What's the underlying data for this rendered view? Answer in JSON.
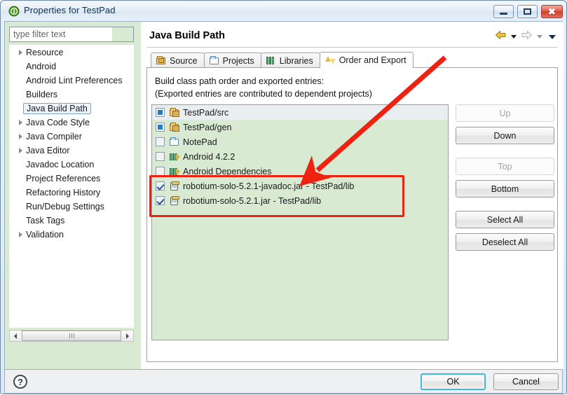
{
  "window": {
    "title": "Properties for TestPad",
    "icon": "info-circle-icon",
    "minimize_label": "Minimize",
    "maximize_label": "Maximize",
    "close_label": "Close"
  },
  "filter": {
    "placeholder": "type filter text",
    "value": ""
  },
  "sidebar": {
    "items": [
      {
        "label": "Resource",
        "expandable": true,
        "selected": false
      },
      {
        "label": "Android",
        "expandable": false,
        "selected": false
      },
      {
        "label": "Android Lint Preferences",
        "expandable": false,
        "selected": false
      },
      {
        "label": "Builders",
        "expandable": false,
        "selected": false
      },
      {
        "label": "Java Build Path",
        "expandable": false,
        "selected": true
      },
      {
        "label": "Java Code Style",
        "expandable": true,
        "selected": false
      },
      {
        "label": "Java Compiler",
        "expandable": true,
        "selected": false
      },
      {
        "label": "Java Editor",
        "expandable": true,
        "selected": false
      },
      {
        "label": "Javadoc Location",
        "expandable": false,
        "selected": false
      },
      {
        "label": "Project References",
        "expandable": false,
        "selected": false
      },
      {
        "label": "Refactoring History",
        "expandable": false,
        "selected": false
      },
      {
        "label": "Run/Debug Settings",
        "expandable": false,
        "selected": false
      },
      {
        "label": "Task Tags",
        "expandable": false,
        "selected": false
      },
      {
        "label": "Validation",
        "expandable": true,
        "selected": false
      }
    ],
    "scrollbar": {
      "left_arrow": "scroll-left-icon",
      "right_arrow": "scroll-right-icon"
    }
  },
  "main": {
    "title": "Java Build Path",
    "nav": {
      "back": "back-arrow-icon",
      "back_menu": "chevron-down-icon",
      "forward": "forward-arrow-icon",
      "forward_menu": "chevron-down-icon",
      "view_menu": "chevron-down-icon"
    },
    "tabs": [
      {
        "label": "Source",
        "icon": "source-folder-icon",
        "active": false
      },
      {
        "label": "Projects",
        "icon": "project-folder-icon",
        "active": false
      },
      {
        "label": "Libraries",
        "icon": "libraries-icon",
        "active": false
      },
      {
        "label": "Order and Export",
        "icon": "order-export-icon",
        "active": true
      }
    ],
    "description_line1": "Build class path order and exported entries:",
    "description_line2": "(Exported entries are contributed to dependent projects)",
    "entries": [
      {
        "label": "TestPad/src",
        "checkbox": "filled",
        "icon": "source-folder-icon",
        "selected": true
      },
      {
        "label": "TestPad/gen",
        "checkbox": "filled",
        "icon": "source-folder-icon",
        "selected": false
      },
      {
        "label": "NotePad",
        "checkbox": "unchecked",
        "icon": "project-folder-icon",
        "selected": false
      },
      {
        "label": "Android 4.2.2",
        "checkbox": "unchecked",
        "icon": "libraries-icon",
        "selected": false
      },
      {
        "label": "Android Dependencies",
        "checkbox": "unchecked",
        "icon": "libraries-icon",
        "selected": false
      },
      {
        "label": "robotium-solo-5.2.1-javadoc.jar - TestPad/lib",
        "checkbox": "checked",
        "icon": "jar-icon",
        "selected": false
      },
      {
        "label": "robotium-solo-5.2.1.jar - TestPad/lib",
        "checkbox": "checked",
        "icon": "jar-icon",
        "selected": false
      }
    ],
    "buttons": [
      {
        "label": "Up",
        "disabled": true,
        "gap": false
      },
      {
        "label": "Down",
        "disabled": false,
        "gap": false
      },
      {
        "label": "Top",
        "disabled": true,
        "gap": true
      },
      {
        "label": "Bottom",
        "disabled": false,
        "gap": false
      },
      {
        "label": "Select All",
        "disabled": false,
        "gap": true
      },
      {
        "label": "Deselect All",
        "disabled": false,
        "gap": false
      }
    ]
  },
  "footer": {
    "help": "?",
    "ok_label": "OK",
    "cancel_label": "Cancel"
  },
  "annotations": {
    "highlight_color": "#ee2211",
    "rectangle_target": "jar-entries",
    "arrow_target": "robotium-solo-5.2.1-javadoc.jar"
  }
}
